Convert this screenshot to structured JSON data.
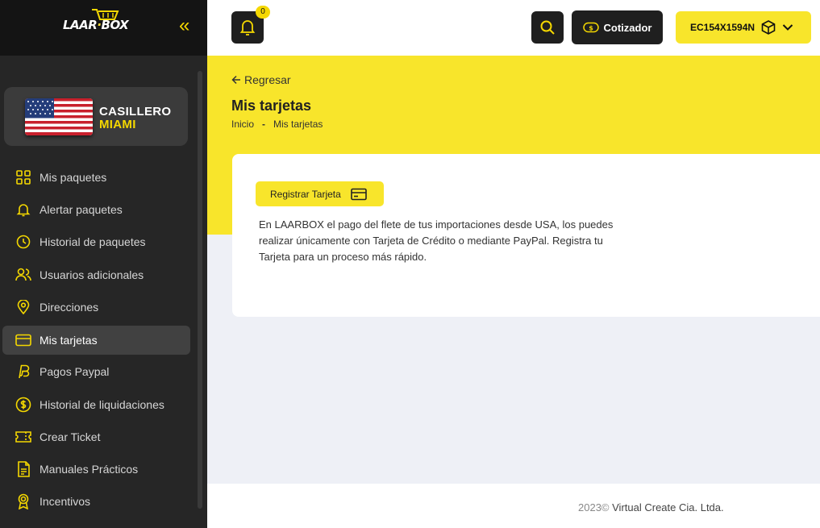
{
  "brand": {
    "logo_left": "LAAR",
    "logo_right": "BOX"
  },
  "casillero": {
    "title": "CASILLERO",
    "subtitle": "MIAMI"
  },
  "sidebar": {
    "items": [
      {
        "label": "Mis paquetes",
        "icon": "grid-icon"
      },
      {
        "label": "Alertar paquetes",
        "icon": "bell-icon"
      },
      {
        "label": "Historial de paquetes",
        "icon": "clock-icon"
      },
      {
        "label": "Usuarios adicionales",
        "icon": "users-icon"
      },
      {
        "label": "Direcciones",
        "icon": "map-pin-icon"
      },
      {
        "label": "Mis tarjetas",
        "icon": "credit-card-icon",
        "active": true
      },
      {
        "label": "Pagos Paypal",
        "icon": "paypal-icon"
      },
      {
        "label": "Historial de liquidaciones",
        "icon": "dollar-circle-icon"
      },
      {
        "label": "Crear Ticket",
        "icon": "ticket-icon"
      },
      {
        "label": "Manuales Prácticos",
        "icon": "document-icon"
      },
      {
        "label": "Incentivos",
        "icon": "award-icon"
      }
    ]
  },
  "header": {
    "notifications_count": "0",
    "cotizador_label": "Cotizador",
    "account_code": "EC154X1594N"
  },
  "page": {
    "back_label": "Regresar",
    "title": "Mis tarjetas",
    "breadcrumb": {
      "home": "Inicio",
      "separator": "-",
      "current": "Mis tarjetas"
    }
  },
  "card": {
    "register_label": "Registrar Tarjeta",
    "description": "En LAARBOX el pago del flete de tus importaciones desde USA, los puedes realizar únicamente con Tarjeta de Crédito o mediante PayPal. Registra tu Tarjeta para un proceso más rápido."
  },
  "footer": {
    "year": "2023©",
    "company": "Virtual Create Cia. Ltda."
  },
  "colors": {
    "accent": "#f8e52b",
    "sidebar_bg": "#262626",
    "dark_button": "#1f1f1f"
  }
}
